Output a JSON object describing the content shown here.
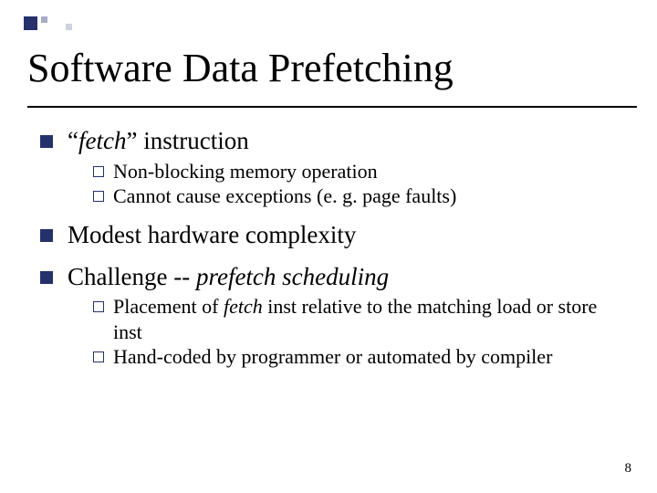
{
  "title": "Software Data Prefetching",
  "page_number": "8",
  "bullets": {
    "b1": {
      "pre": "“",
      "kw": "fetch",
      "post": "” instruction"
    },
    "b1_subs": {
      "s1": "Non-blocking memory operation",
      "s2": "Cannot cause exceptions (e. g. page faults)"
    },
    "b2": "Modest hardware complexity",
    "b3": {
      "pre": "Challenge -- ",
      "kw": "prefetch scheduling"
    },
    "b3_subs": {
      "s1": {
        "a": "Placement of ",
        "b": "fetch",
        "c": " inst relative to the matching load or store inst"
      },
      "s2": "Hand-coded by programmer or automated by compiler"
    }
  }
}
